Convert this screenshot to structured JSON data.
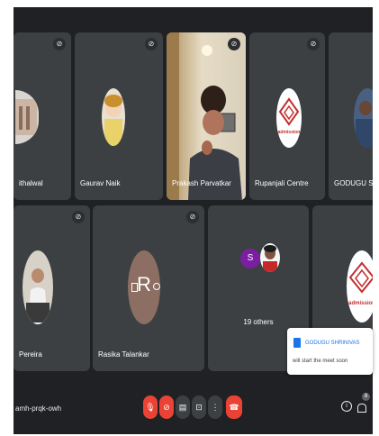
{
  "participants": {
    "row1": [
      {
        "name": "ithalwal"
      },
      {
        "name": "Gaurav Naik"
      },
      {
        "name": "Prakash Parvatkar"
      },
      {
        "name": "Rupanjali Centre"
      },
      {
        "name": "GODUGU SHRINIVAS"
      }
    ],
    "row2": [
      {
        "name": "Pereira"
      },
      {
        "name": "Rasika Talankar"
      },
      {
        "name": "19 others"
      }
    ],
    "avatar_letters": {
      "rasika": "R",
      "others": "S"
    }
  },
  "logo_text": "admission",
  "toast": {
    "title": "GODUGU SHRINIVAS",
    "message": "will start the meet soon"
  },
  "meeting_code": "amh-prqk-owh",
  "participant_count": "8",
  "colors": {
    "mic_off_red": "#ea4335",
    "end_call_red": "#ea4335",
    "tile": "#3c4043",
    "background": "#202124"
  }
}
